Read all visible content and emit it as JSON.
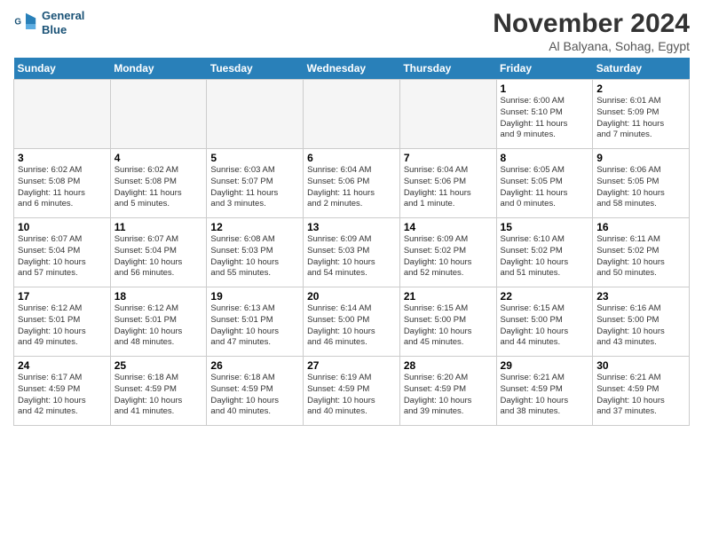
{
  "logo": {
    "line1": "General",
    "line2": "Blue"
  },
  "title": "November 2024",
  "location": "Al Balyana, Sohag, Egypt",
  "days_of_week": [
    "Sunday",
    "Monday",
    "Tuesday",
    "Wednesday",
    "Thursday",
    "Friday",
    "Saturday"
  ],
  "weeks": [
    [
      {
        "day": "",
        "info": "",
        "empty": true
      },
      {
        "day": "",
        "info": "",
        "empty": true
      },
      {
        "day": "",
        "info": "",
        "empty": true
      },
      {
        "day": "",
        "info": "",
        "empty": true
      },
      {
        "day": "",
        "info": "",
        "empty": true
      },
      {
        "day": "1",
        "info": "Sunrise: 6:00 AM\nSunset: 5:10 PM\nDaylight: 11 hours\nand 9 minutes."
      },
      {
        "day": "2",
        "info": "Sunrise: 6:01 AM\nSunset: 5:09 PM\nDaylight: 11 hours\nand 7 minutes."
      }
    ],
    [
      {
        "day": "3",
        "info": "Sunrise: 6:02 AM\nSunset: 5:08 PM\nDaylight: 11 hours\nand 6 minutes."
      },
      {
        "day": "4",
        "info": "Sunrise: 6:02 AM\nSunset: 5:08 PM\nDaylight: 11 hours\nand 5 minutes."
      },
      {
        "day": "5",
        "info": "Sunrise: 6:03 AM\nSunset: 5:07 PM\nDaylight: 11 hours\nand 3 minutes."
      },
      {
        "day": "6",
        "info": "Sunrise: 6:04 AM\nSunset: 5:06 PM\nDaylight: 11 hours\nand 2 minutes."
      },
      {
        "day": "7",
        "info": "Sunrise: 6:04 AM\nSunset: 5:06 PM\nDaylight: 11 hours\nand 1 minute."
      },
      {
        "day": "8",
        "info": "Sunrise: 6:05 AM\nSunset: 5:05 PM\nDaylight: 11 hours\nand 0 minutes."
      },
      {
        "day": "9",
        "info": "Sunrise: 6:06 AM\nSunset: 5:05 PM\nDaylight: 10 hours\nand 58 minutes."
      }
    ],
    [
      {
        "day": "10",
        "info": "Sunrise: 6:07 AM\nSunset: 5:04 PM\nDaylight: 10 hours\nand 57 minutes."
      },
      {
        "day": "11",
        "info": "Sunrise: 6:07 AM\nSunset: 5:04 PM\nDaylight: 10 hours\nand 56 minutes."
      },
      {
        "day": "12",
        "info": "Sunrise: 6:08 AM\nSunset: 5:03 PM\nDaylight: 10 hours\nand 55 minutes."
      },
      {
        "day": "13",
        "info": "Sunrise: 6:09 AM\nSunset: 5:03 PM\nDaylight: 10 hours\nand 54 minutes."
      },
      {
        "day": "14",
        "info": "Sunrise: 6:09 AM\nSunset: 5:02 PM\nDaylight: 10 hours\nand 52 minutes."
      },
      {
        "day": "15",
        "info": "Sunrise: 6:10 AM\nSunset: 5:02 PM\nDaylight: 10 hours\nand 51 minutes."
      },
      {
        "day": "16",
        "info": "Sunrise: 6:11 AM\nSunset: 5:02 PM\nDaylight: 10 hours\nand 50 minutes."
      }
    ],
    [
      {
        "day": "17",
        "info": "Sunrise: 6:12 AM\nSunset: 5:01 PM\nDaylight: 10 hours\nand 49 minutes."
      },
      {
        "day": "18",
        "info": "Sunrise: 6:12 AM\nSunset: 5:01 PM\nDaylight: 10 hours\nand 48 minutes."
      },
      {
        "day": "19",
        "info": "Sunrise: 6:13 AM\nSunset: 5:01 PM\nDaylight: 10 hours\nand 47 minutes."
      },
      {
        "day": "20",
        "info": "Sunrise: 6:14 AM\nSunset: 5:00 PM\nDaylight: 10 hours\nand 46 minutes."
      },
      {
        "day": "21",
        "info": "Sunrise: 6:15 AM\nSunset: 5:00 PM\nDaylight: 10 hours\nand 45 minutes."
      },
      {
        "day": "22",
        "info": "Sunrise: 6:15 AM\nSunset: 5:00 PM\nDaylight: 10 hours\nand 44 minutes."
      },
      {
        "day": "23",
        "info": "Sunrise: 6:16 AM\nSunset: 5:00 PM\nDaylight: 10 hours\nand 43 minutes."
      }
    ],
    [
      {
        "day": "24",
        "info": "Sunrise: 6:17 AM\nSunset: 4:59 PM\nDaylight: 10 hours\nand 42 minutes."
      },
      {
        "day": "25",
        "info": "Sunrise: 6:18 AM\nSunset: 4:59 PM\nDaylight: 10 hours\nand 41 minutes."
      },
      {
        "day": "26",
        "info": "Sunrise: 6:18 AM\nSunset: 4:59 PM\nDaylight: 10 hours\nand 40 minutes."
      },
      {
        "day": "27",
        "info": "Sunrise: 6:19 AM\nSunset: 4:59 PM\nDaylight: 10 hours\nand 40 minutes."
      },
      {
        "day": "28",
        "info": "Sunrise: 6:20 AM\nSunset: 4:59 PM\nDaylight: 10 hours\nand 39 minutes."
      },
      {
        "day": "29",
        "info": "Sunrise: 6:21 AM\nSunset: 4:59 PM\nDaylight: 10 hours\nand 38 minutes."
      },
      {
        "day": "30",
        "info": "Sunrise: 6:21 AM\nSunset: 4:59 PM\nDaylight: 10 hours\nand 37 minutes."
      }
    ]
  ]
}
